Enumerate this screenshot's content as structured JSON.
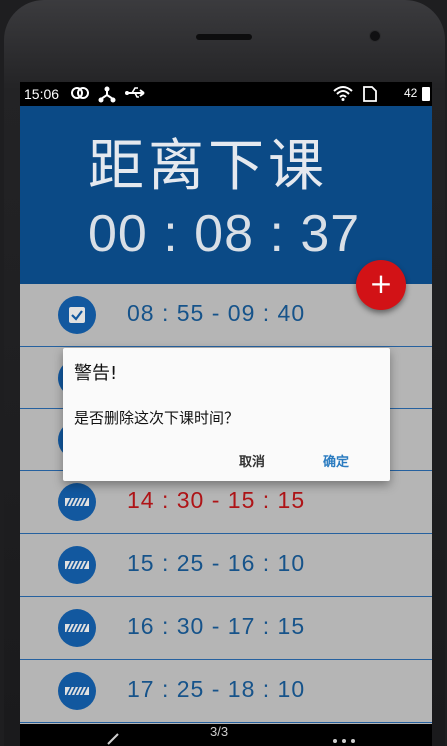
{
  "status_bar": {
    "time": "15:06",
    "battery": "42"
  },
  "header": {
    "title": "距离下课",
    "countdown": "00 : 08 : 37"
  },
  "fab": {
    "label": "+"
  },
  "schedule": [
    {
      "time": "08 : 55 - 09 : 40",
      "icon": "checkbox-checked-icon",
      "highlight": false
    },
    {
      "time": "",
      "icon": "hatched-bar-icon",
      "highlight": false
    },
    {
      "time": "",
      "icon": "hatched-bar-icon",
      "highlight": false
    },
    {
      "time": "14 : 30 - 15 : 15",
      "icon": "hatched-bar-icon",
      "highlight": true
    },
    {
      "time": "15 : 25 - 16 : 10",
      "icon": "hatched-bar-icon",
      "highlight": false
    },
    {
      "time": "16 : 30 - 17 : 15",
      "icon": "hatched-bar-icon",
      "highlight": false
    },
    {
      "time": "17 : 25 - 18 : 10",
      "icon": "hatched-bar-icon",
      "highlight": false
    }
  ],
  "dialog": {
    "title": "警告!",
    "message": "是否删除这次下课时间？",
    "cancel_label": "取消",
    "ok_label": "确定"
  },
  "nav_bar": {
    "page_indicator": "3/3"
  },
  "colors": {
    "header_bg": "#0b4a86",
    "accent_red": "#d21216",
    "icon_blue": "#1565b5",
    "time_blue": "#1a5f9e",
    "highlight_red": "#c8171b",
    "dialog_ok": "#2a7bc0"
  }
}
